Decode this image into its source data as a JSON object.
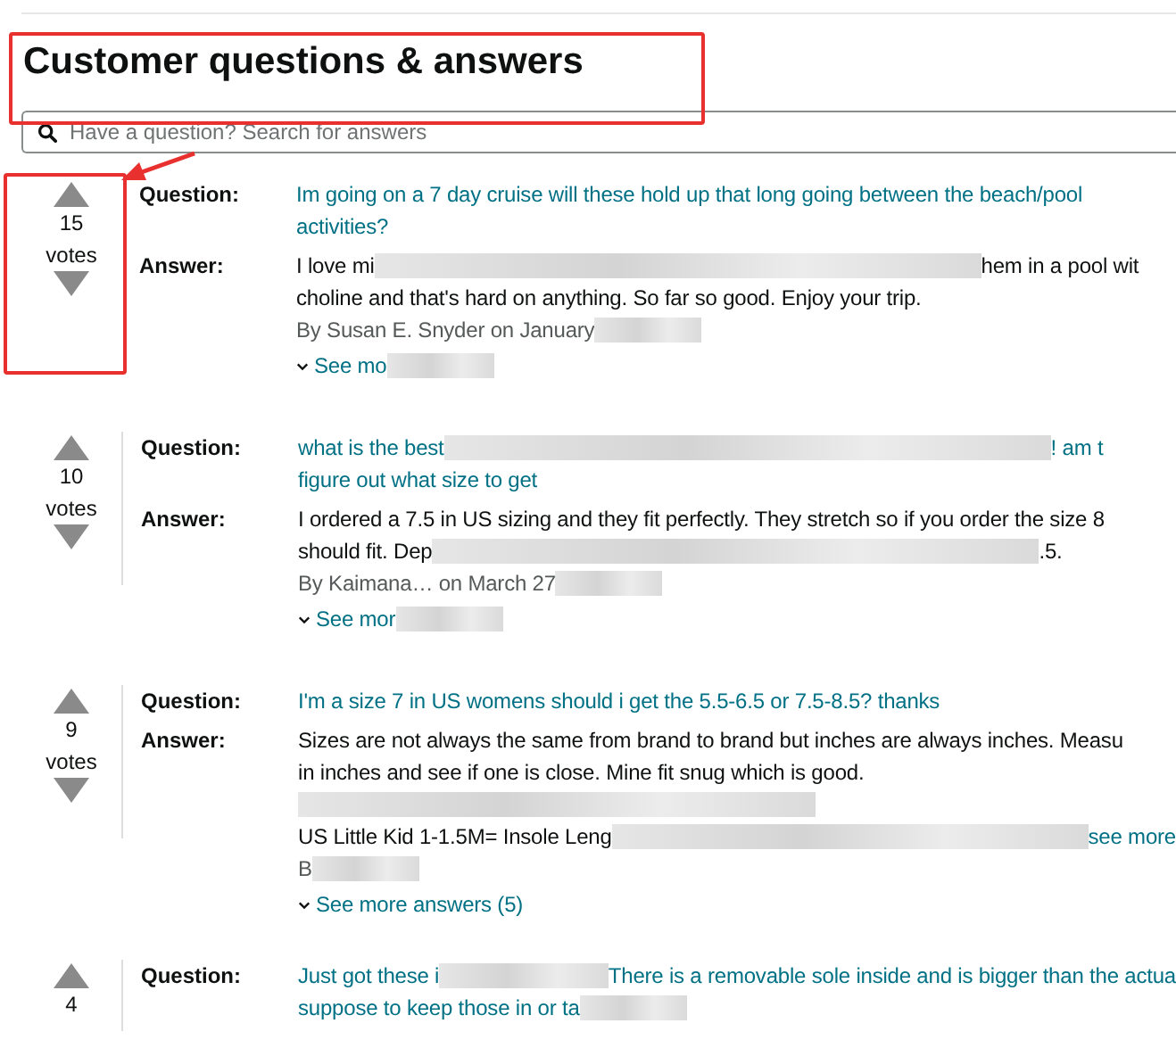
{
  "title": "Customer questions & answers",
  "search": {
    "placeholder": "Have a question? Search for answers"
  },
  "annotations": {
    "highlight_title": true,
    "highlight_votes": true
  },
  "questions": [
    {
      "votes": "15",
      "votes_label": "votes",
      "question_label": "Question:",
      "answer_label": "Answer:",
      "question_lines": [
        [
          {
            "kind": "text",
            "text": "Im going on a 7 day cruise will these hold up that long going between the beach/pool"
          }
        ],
        [
          {
            "kind": "text",
            "text": "activities?"
          }
        ]
      ],
      "answer_lines": [
        {
          "kind": "text",
          "segments": [
            {
              "kind": "text",
              "text": "I love mi"
            },
            {
              "kind": "blur"
            },
            {
              "kind": "text",
              "text": "hem in a pool wit"
            }
          ]
        },
        {
          "kind": "text",
          "segments": [
            {
              "kind": "text",
              "text": "choline and that's hard on anything. So far so good. Enjoy your trip."
            }
          ]
        },
        {
          "kind": "byline",
          "segments": [
            {
              "kind": "text",
              "text": "By Susan E. Snyder on January"
            },
            {
              "kind": "blur"
            }
          ]
        },
        {
          "kind": "more",
          "segments": [
            {
              "kind": "link",
              "text": "See mo"
            },
            {
              "kind": "blur"
            }
          ]
        }
      ]
    },
    {
      "votes": "10",
      "votes_label": "votes",
      "question_label": "Question:",
      "answer_label": "Answer:",
      "question_lines": [
        [
          {
            "kind": "text",
            "text": "what is the best"
          },
          {
            "kind": "blur"
          },
          {
            "kind": "text",
            "text": "! am t"
          }
        ],
        [
          {
            "kind": "text",
            "text": "figure out what size to get"
          }
        ]
      ],
      "answer_lines": [
        {
          "kind": "text",
          "segments": [
            {
              "kind": "text",
              "text": "I ordered a 7.5 in US sizing and they fit perfectly. They stretch so if you order the size 8"
            }
          ]
        },
        {
          "kind": "text",
          "segments": [
            {
              "kind": "text",
              "text": "should fit. Dep"
            },
            {
              "kind": "blur"
            },
            {
              "kind": "text",
              "text": ".5."
            }
          ]
        },
        {
          "kind": "byline",
          "segments": [
            {
              "kind": "text",
              "text": "By Kaimana… on March 27"
            },
            {
              "kind": "blur"
            }
          ]
        },
        {
          "kind": "more",
          "segments": [
            {
              "kind": "link",
              "text": "See mor"
            },
            {
              "kind": "blur"
            }
          ]
        }
      ]
    },
    {
      "votes": "9",
      "votes_label": "votes",
      "question_label": "Question:",
      "answer_label": "Answer:",
      "question_lines": [
        [
          {
            "kind": "text",
            "text": "I'm a size 7 in US womens should i get the 5.5-6.5 or 7.5-8.5? thanks"
          }
        ]
      ],
      "answer_lines": [
        {
          "kind": "text",
          "segments": [
            {
              "kind": "text",
              "text": "Sizes are not always the same from brand to brand but inches are always inches. Measu"
            }
          ]
        },
        {
          "kind": "text",
          "segments": [
            {
              "kind": "text",
              "text": "in inches and see if one is close. Mine fit snug which is good."
            }
          ]
        },
        {
          "kind": "text",
          "segments": [
            {
              "kind": "blur"
            }
          ]
        },
        {
          "kind": "text",
          "segments": [
            {
              "kind": "text",
              "text": "US Little Kid 1-1.5M= Insole Leng"
            },
            {
              "kind": "blur"
            },
            {
              "kind": "link",
              "text": "see more"
            }
          ]
        },
        {
          "kind": "byline",
          "segments": [
            {
              "kind": "text",
              "text": "B"
            },
            {
              "kind": "blur"
            }
          ]
        },
        {
          "kind": "more",
          "segments": [
            {
              "kind": "link",
              "text": "See more answers (5)"
            }
          ]
        }
      ]
    },
    {
      "votes": "4",
      "question_label": "Question:",
      "question_lines": [
        [
          {
            "kind": "text",
            "text": "Just got these i"
          },
          {
            "kind": "blur"
          },
          {
            "kind": "text",
            "text": "There is a removable sole inside and is bigger than the actua"
          }
        ],
        [
          {
            "kind": "text",
            "text": "suppose to keep those in or ta"
          },
          {
            "kind": "blur"
          }
        ]
      ]
    }
  ]
}
